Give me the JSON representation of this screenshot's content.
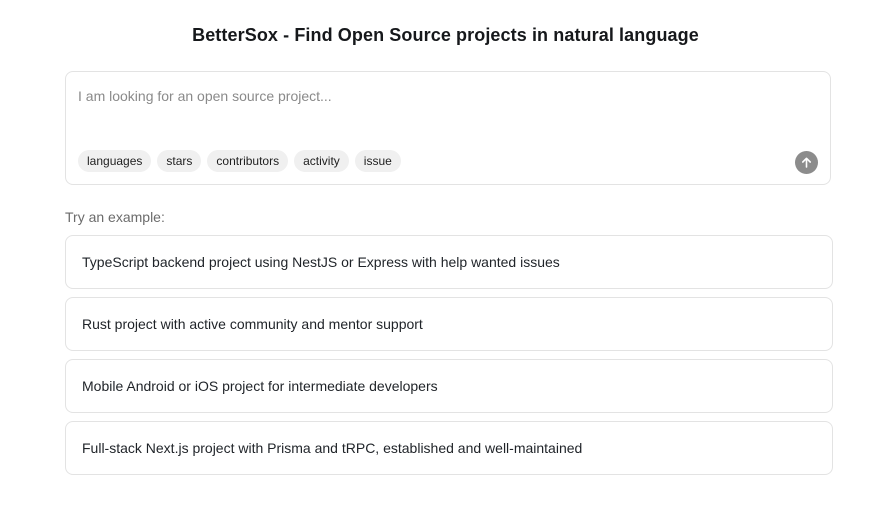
{
  "header": {
    "title": "BetterSox - Find Open Source projects in natural language"
  },
  "search": {
    "placeholder": "I am looking for an open source project...",
    "value": "",
    "chips": [
      "languages",
      "stars",
      "contributors",
      "activity",
      "issue"
    ],
    "submit_icon": "arrow-up-icon"
  },
  "examples": {
    "label": "Try an example:",
    "items": [
      "TypeScript backend project using NestJS or Express with help wanted issues",
      "Rust project with active community and mentor support",
      "Mobile Android or iOS project for intermediate developers",
      "Full-stack Next.js project with Prisma and tRPC, established and well-maintained"
    ]
  },
  "colors": {
    "submit_button": "#8c8c8c",
    "chip_background": "#f0f0f0",
    "border": "#e3e3e3"
  }
}
